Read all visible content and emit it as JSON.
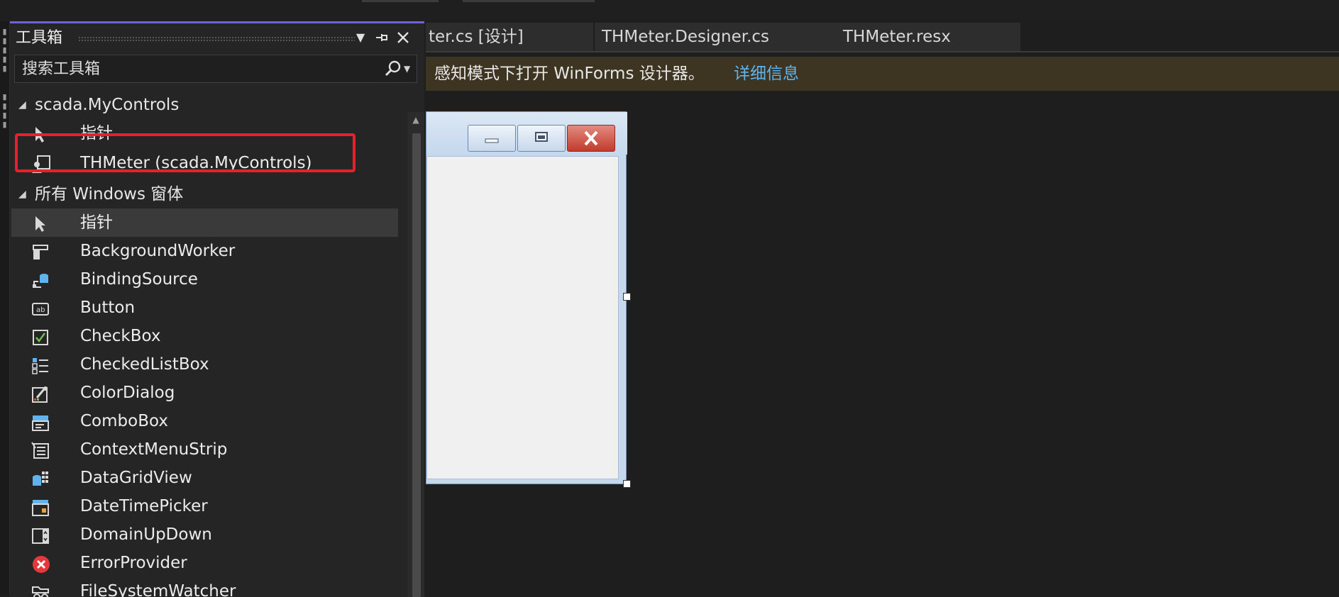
{
  "toolbox": {
    "title": "工具箱",
    "search_placeholder": "搜索工具箱",
    "groups": [
      {
        "label": "scada.MyControls",
        "items": [
          {
            "label": "指针",
            "icon": "pointer-icon"
          },
          {
            "label": "THMeter (scada.MyControls)",
            "icon": "user-control-icon",
            "highlighted": true
          }
        ]
      },
      {
        "label": "所有 Windows 窗体",
        "items": [
          {
            "label": "指针",
            "icon": "pointer-icon",
            "selected": true
          },
          {
            "label": "BackgroundWorker",
            "icon": "background-worker-icon"
          },
          {
            "label": "BindingSource",
            "icon": "binding-source-icon"
          },
          {
            "label": "Button",
            "icon": "button-icon"
          },
          {
            "label": "CheckBox",
            "icon": "checkbox-icon"
          },
          {
            "label": "CheckedListBox",
            "icon": "checked-list-box-icon"
          },
          {
            "label": "ColorDialog",
            "icon": "color-dialog-icon"
          },
          {
            "label": "ComboBox",
            "icon": "combo-box-icon"
          },
          {
            "label": "ContextMenuStrip",
            "icon": "context-menu-strip-icon"
          },
          {
            "label": "DataGridView",
            "icon": "data-grid-view-icon"
          },
          {
            "label": "DateTimePicker",
            "icon": "date-time-picker-icon"
          },
          {
            "label": "DomainUpDown",
            "icon": "domain-up-down-icon"
          },
          {
            "label": "ErrorProvider",
            "icon": "error-provider-icon"
          },
          {
            "label": "FileSystemWatcher",
            "icon": "file-system-watcher-icon"
          }
        ]
      }
    ]
  },
  "tabs": [
    {
      "label": "ter.cs [设计]"
    },
    {
      "label": "THMeter.Designer.cs"
    },
    {
      "label": "THMeter.resx"
    }
  ],
  "infobar": {
    "message": "感知模式下打开 WinForms 设计器。",
    "link": "详细信息"
  },
  "colors": {
    "accent": "#6f63d8",
    "highlight_box": "#e8202a",
    "link": "#5fb4ee",
    "infobar_bg": "#3e3422"
  }
}
